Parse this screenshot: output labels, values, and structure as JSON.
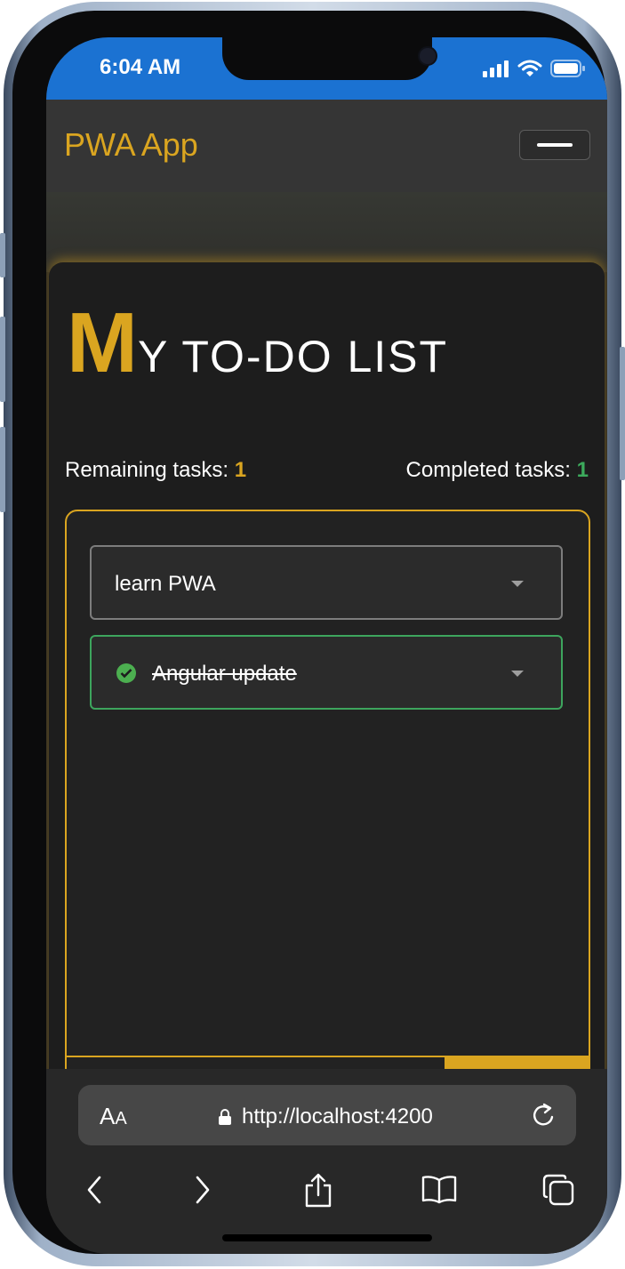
{
  "status_bar": {
    "time": "6:04 AM"
  },
  "header": {
    "title": "PWA App"
  },
  "page": {
    "title_initial": "M",
    "title_rest": "Y TO-DO LIST"
  },
  "stats": {
    "remaining_label": "Remaining tasks:",
    "remaining_count": "1",
    "completed_label": "Completed tasks:",
    "completed_count": "1"
  },
  "todos": [
    {
      "text": "learn PWA",
      "completed": false
    },
    {
      "text": "Angular update",
      "completed": true
    }
  ],
  "browser": {
    "text_size_big": "A",
    "text_size_small": "A",
    "url": "http://localhost:4200"
  },
  "colors": {
    "accent": "#daa520",
    "success": "#3caa5c",
    "status_bar": "#1b72d2"
  },
  "icons": [
    "signal-icon",
    "wifi-icon",
    "battery-icon",
    "menu-icon",
    "check-circle-icon",
    "chevron-down-icon",
    "lock-icon",
    "reload-icon",
    "back-icon",
    "forward-icon",
    "share-icon",
    "bookmarks-icon",
    "tabs-icon"
  ]
}
